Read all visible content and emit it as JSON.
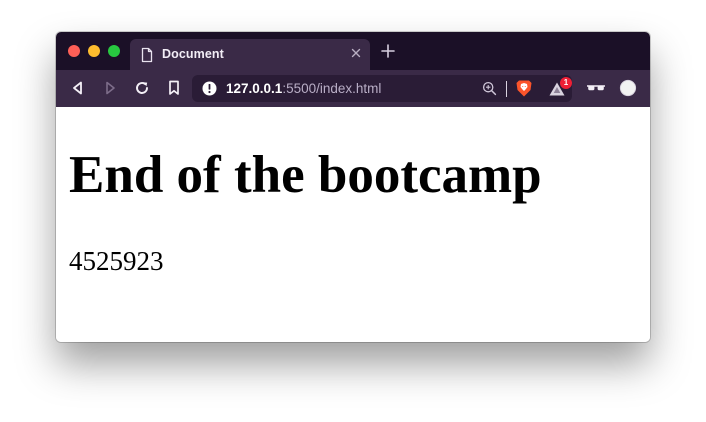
{
  "browser": {
    "tab": {
      "title": "Document",
      "close_icon": "close-icon",
      "file_icon": "document-icon"
    },
    "new_tab_icon": "plus-icon",
    "toolbar": {
      "back_icon": "back-icon",
      "forward_icon": "forward-icon",
      "reload_icon": "reload-icon",
      "bookmark_icon": "bookmark-icon",
      "site_info_icon": "info-icon",
      "zoom_icon": "zoom-icon",
      "brave_shields_icon": "brave-lion-icon",
      "rewards_icon": "rewards-triangle-icon",
      "rewards_badge": "1",
      "reader_icon": "glasses-icon",
      "profile_icon": "profile-icon"
    },
    "address": {
      "host": "127.0.0.1",
      "rest": ":5500/index.html"
    },
    "colors": {
      "tabstrip": "#1b1027",
      "toolbar": "#3a2a47",
      "urlbar": "#2a1c36",
      "brave_orange": "#fb542b",
      "badge_red": "#ee1f35"
    }
  },
  "page": {
    "heading": "End of the bootcamp",
    "number": "4525923"
  }
}
